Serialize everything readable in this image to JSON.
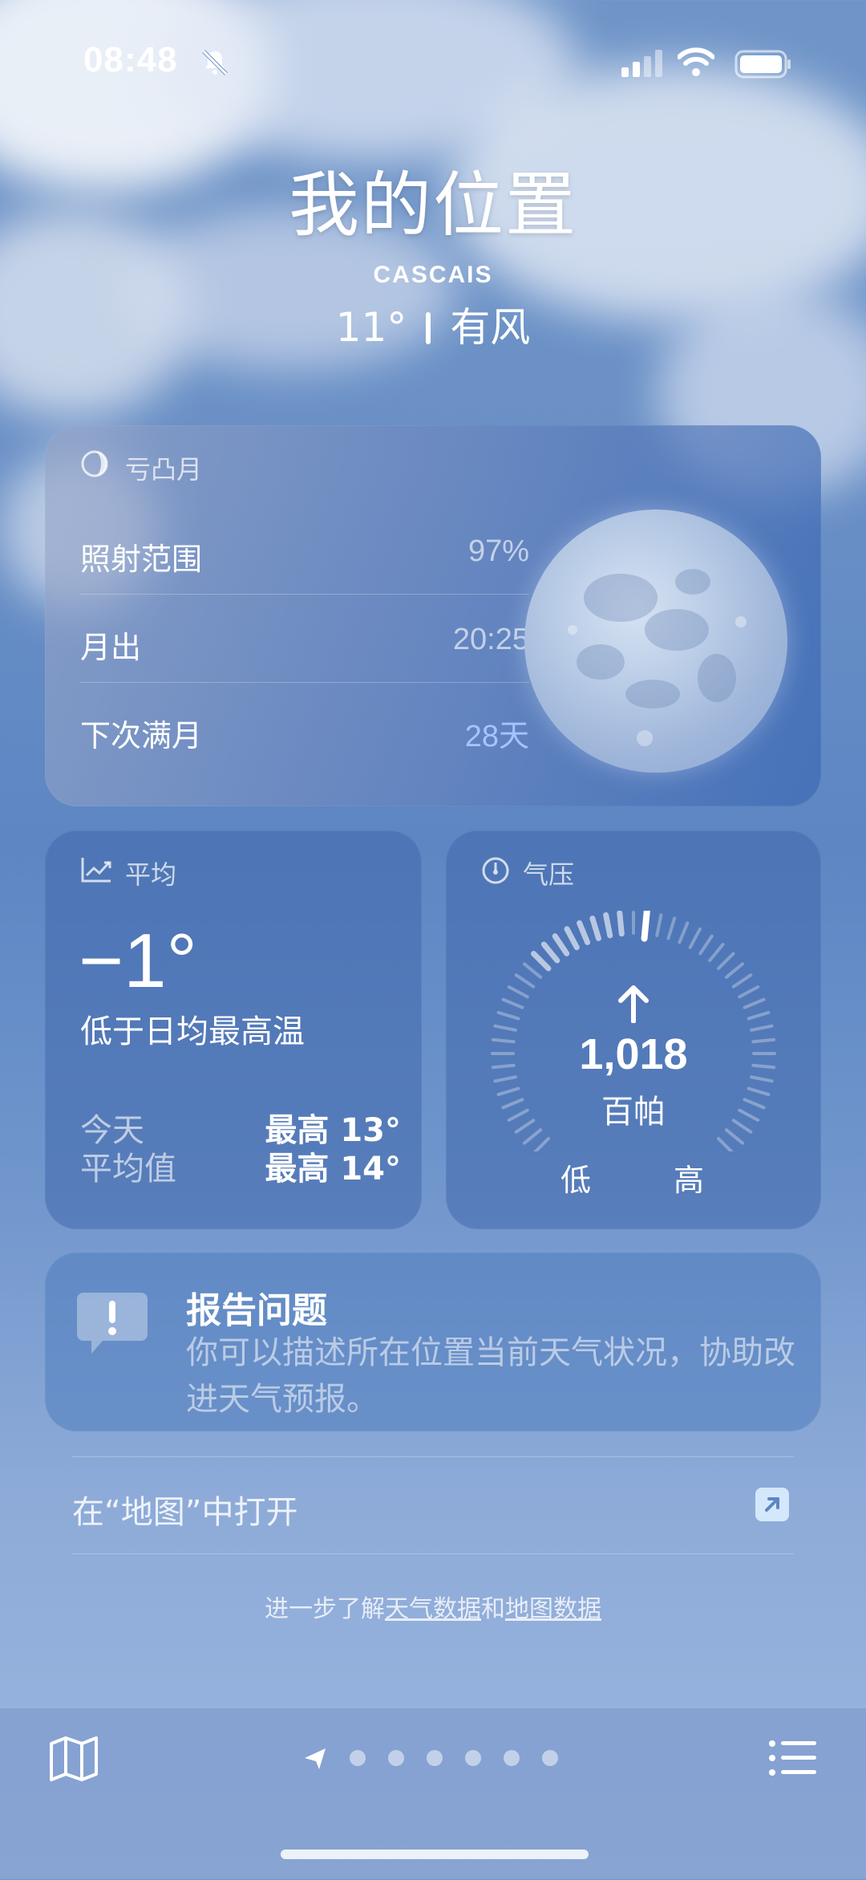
{
  "status_bar": {
    "time": "08:48"
  },
  "header": {
    "location_title": "我的位置",
    "city": "CASCAIS",
    "temperature": "11°",
    "condition": "有风"
  },
  "moon_card": {
    "phase_label": "亏凸月",
    "rows": [
      {
        "label": "照射范围",
        "value": "97%"
      },
      {
        "label": "月出",
        "value": "20:25"
      },
      {
        "label": "下次满月",
        "value": "28天"
      }
    ]
  },
  "average_card": {
    "title": "平均",
    "value": "−1°",
    "description": "低于日均最高温",
    "today_label": "今天",
    "today_value": "最高 13°",
    "avg_label": "平均值",
    "avg_value": "最高 14°"
  },
  "pressure_card": {
    "title": "气压",
    "value": "1,018",
    "unit": "百帕",
    "low_label": "低",
    "high_label": "高",
    "trend": "rising"
  },
  "report_card": {
    "title": "报告问题",
    "description": "你可以描述所在位置当前天气状况，协助改进天气预报。"
  },
  "open_in_maps": {
    "label": "在“地图”中打开"
  },
  "footer": {
    "prefix": "进一步了解",
    "weather_data_link": "天气数据",
    "conj": "和",
    "map_data_link": "地图数据"
  },
  "tab_bar": {
    "page_count": 6,
    "active_index": 0
  },
  "colors": {
    "card": "#4a6fb0",
    "accent_blue": "#a6c3ff"
  }
}
